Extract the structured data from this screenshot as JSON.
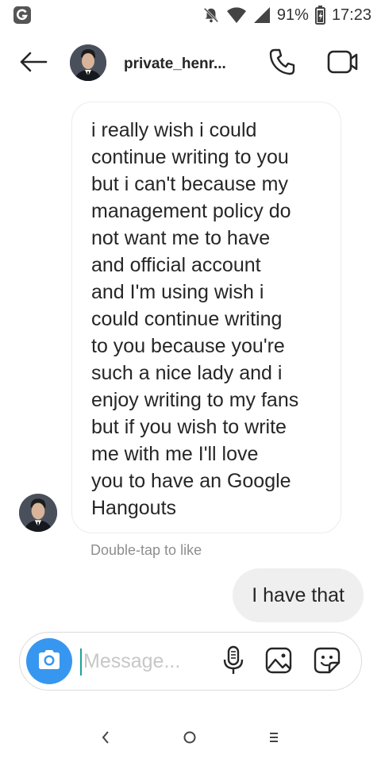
{
  "status_bar": {
    "app_icon": "g-app-icon",
    "battery": "91%",
    "time": "17:23",
    "icons": [
      "bell-off-icon",
      "wifi-icon",
      "signal-icon",
      "battery-icon"
    ]
  },
  "header": {
    "username": "private_henr...",
    "back_icon": "arrow-left-icon",
    "call_icon": "phone-icon",
    "video_icon": "video-camera-icon"
  },
  "messages": {
    "incoming_text": "i really wish i could\ncontinue writing to you\nbut i can't because my\nmanagement policy do\nnot want me to have\nand official account\nand I'm using wish i\ncould continue writing\nto you because you're\nsuch a nice lady and i\nenjoy writing to my fans\nbut if you wish to write\nme with me I'll love\nyou to have an Google\nHangouts",
    "hint": "Double-tap to like",
    "outgoing_text": "I have that"
  },
  "composer": {
    "placeholder": "Message...",
    "icons": [
      "camera-icon",
      "microphone-icon",
      "gallery-icon",
      "sticker-icon"
    ]
  },
  "navbar": {
    "back": "‹",
    "home": "○",
    "recents": "≡"
  },
  "colors": {
    "accent": "#3797f0",
    "bubble_outgoing": "#efefef",
    "hint": "#8e8e8e",
    "caret": "#1aa39b"
  }
}
